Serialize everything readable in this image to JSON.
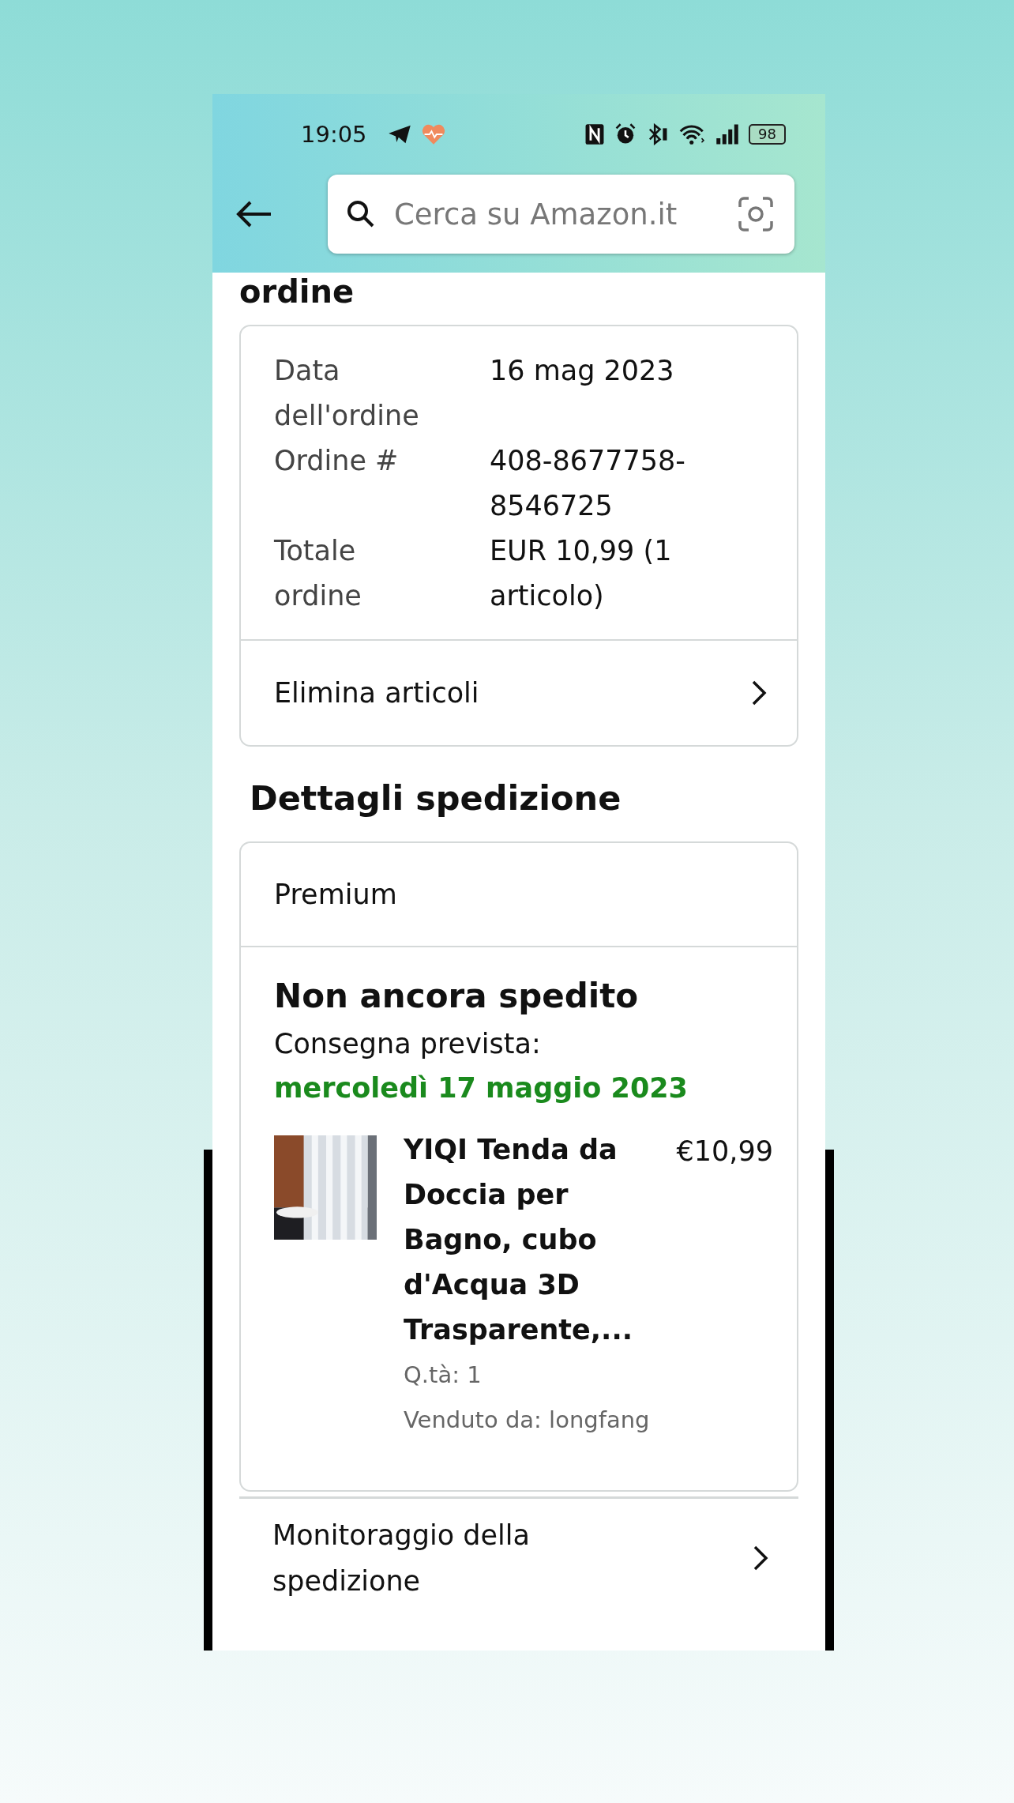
{
  "status_bar": {
    "time": "19:05",
    "battery": "98"
  },
  "search": {
    "placeholder": "Cerca su Amazon.it"
  },
  "page_title": "ordine",
  "order_summary": {
    "rows": [
      {
        "label": "Data dell'ordine",
        "value": "16 mag 2023"
      },
      {
        "label": "Ordine #",
        "value": "408-8677758-8546725"
      },
      {
        "label": "Totale ordine",
        "value": "EUR 10,99 (1 articolo)"
      }
    ],
    "action": "Elimina articoli"
  },
  "shipping": {
    "heading": "Dettagli spedizione",
    "service": "Premium",
    "status": "Non ancora spedito",
    "delivery_label": "Consegna prevista:",
    "delivery_date": "mercoledì 17 maggio 2023",
    "items": [
      {
        "kind": "picture",
        "title": "YIQI Tenda da Doccia per Bagno, cubo d'Acqua 3D Trasparente,...",
        "price": "€10,99",
        "quantity": "Q.tà: 1",
        "seller": "Venduto da: longfang"
      }
    ]
  },
  "tracking": "Monitoraggio della spedizione"
}
